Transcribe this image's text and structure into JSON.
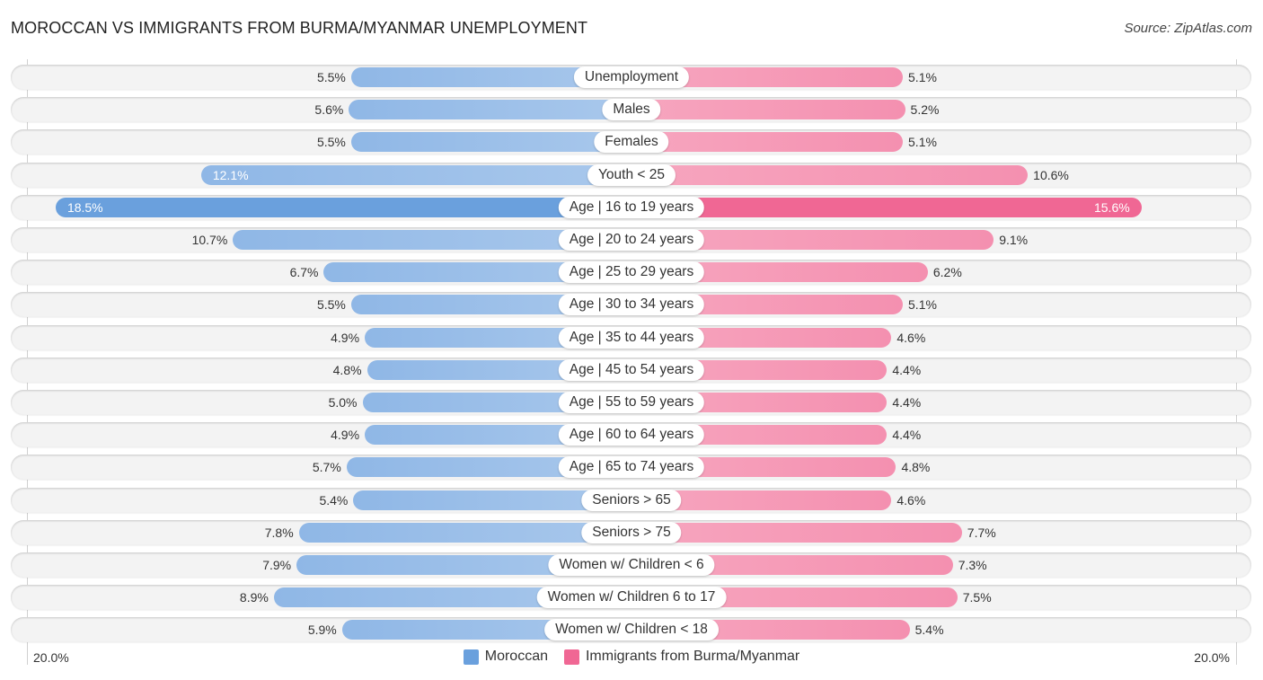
{
  "title": "MOROCCAN VS IMMIGRANTS FROM BURMA/MYANMAR UNEMPLOYMENT",
  "source": "Source: ZipAtlas.com",
  "axis": {
    "left_label": "20.0%",
    "right_label": "20.0%"
  },
  "legend": [
    {
      "name": "Moroccan",
      "color": "#6aa0dd"
    },
    {
      "name": "Immigrants from Burma/Myanmar",
      "color": "#f06794"
    }
  ],
  "chart_data": {
    "type": "bar",
    "orientation": "horizontal-diverging",
    "title": "MOROCCAN VS IMMIGRANTS FROM BURMA/MYANMAR UNEMPLOYMENT",
    "xlim": [
      -20,
      20
    ],
    "unit": "%",
    "legend_position": "bottom-center",
    "categories": [
      "Unemployment",
      "Males",
      "Females",
      "Youth < 25",
      "Age | 16 to 19 years",
      "Age | 20 to 24 years",
      "Age | 25 to 29 years",
      "Age | 30 to 34 years",
      "Age | 35 to 44 years",
      "Age | 45 to 54 years",
      "Age | 55 to 59 years",
      "Age | 60 to 64 years",
      "Age | 65 to 74 years",
      "Seniors > 65",
      "Seniors > 75",
      "Women w/ Children < 6",
      "Women w/ Children 6 to 17",
      "Women w/ Children < 18"
    ],
    "series": [
      {
        "name": "Moroccan",
        "color": "#6aa0dd",
        "values": [
          5.5,
          5.6,
          5.5,
          12.1,
          18.5,
          10.7,
          6.7,
          5.5,
          4.9,
          4.8,
          5.0,
          4.9,
          5.7,
          5.4,
          7.8,
          7.9,
          8.9,
          5.9
        ]
      },
      {
        "name": "Immigrants from Burma/Myanmar",
        "color": "#f06794",
        "values": [
          5.1,
          5.2,
          5.1,
          10.6,
          15.6,
          9.1,
          6.2,
          5.1,
          4.6,
          4.4,
          4.4,
          4.4,
          4.8,
          4.6,
          7.7,
          7.3,
          7.5,
          5.4
        ]
      }
    ],
    "value_labels": {
      "left": [
        "5.5%",
        "5.6%",
        "5.5%",
        "12.1%",
        "18.5%",
        "10.7%",
        "6.7%",
        "5.5%",
        "4.9%",
        "4.8%",
        "5.0%",
        "4.9%",
        "5.7%",
        "5.4%",
        "7.8%",
        "7.9%",
        "8.9%",
        "5.9%"
      ],
      "right": [
        "5.1%",
        "5.2%",
        "5.1%",
        "10.6%",
        "15.6%",
        "9.1%",
        "6.2%",
        "5.1%",
        "4.6%",
        "4.4%",
        "4.4%",
        "4.4%",
        "4.8%",
        "4.6%",
        "7.7%",
        "7.3%",
        "7.5%",
        "5.4%"
      ]
    }
  }
}
